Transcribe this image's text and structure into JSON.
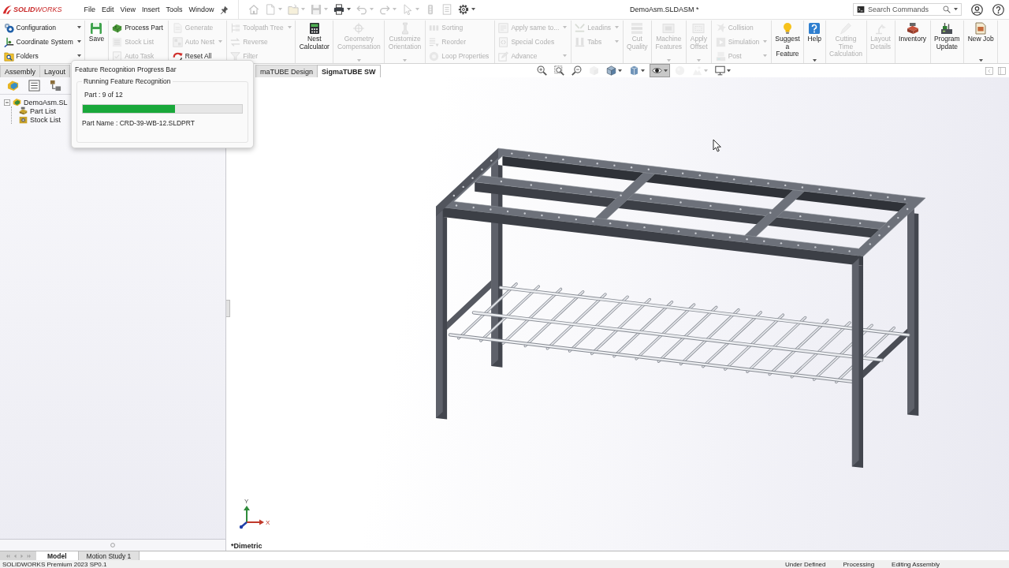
{
  "title_bar": {
    "logo": "**SOLID**WORKS",
    "menu": [
      "File",
      "Edit",
      "View",
      "Insert",
      "Tools",
      "Window"
    ],
    "quick_access": [
      {
        "disabled": true,
        "menu": false
      },
      {
        "disabled": true,
        "menu": true
      },
      {
        "disabled": true,
        "menu": true
      },
      {
        "disabled": true,
        "menu": true
      },
      {
        "disabled": false,
        "menu": true
      },
      {
        "disabled": true,
        "menu": true
      },
      {
        "disabled": true,
        "menu": true
      },
      {
        "disabled": true,
        "menu": true
      },
      {
        "disabled": true,
        "menu": false
      },
      {
        "disabled": true,
        "menu": false
      },
      {
        "disabled": false,
        "menu": true
      }
    ],
    "document_title": "DemoAsm.SLDASM *",
    "search": {
      "placeholder": "Search Commands"
    }
  },
  "ribbon": {
    "groups": [
      {
        "kind": "stack",
        "items": [
          {
            "label": "Configuration",
            "disabled": false,
            "menu": true
          },
          {
            "label": "Coordinate System",
            "disabled": false,
            "menu": true
          },
          {
            "label": "Folders",
            "disabled": false,
            "menu": true
          }
        ]
      },
      {
        "kind": "large",
        "label": "Save",
        "disabled": false,
        "menu": false
      },
      {
        "kind": "stack",
        "items": [
          {
            "label": "Process Part",
            "disabled": false,
            "menu": false
          },
          {
            "label": "Stock List",
            "disabled": true,
            "menu": false
          },
          {
            "label": "Auto Task",
            "disabled": true,
            "menu": false
          }
        ]
      },
      {
        "kind": "stack",
        "items": [
          {
            "label": "Generate",
            "disabled": true,
            "menu": false
          },
          {
            "label": "Auto Nest",
            "disabled": true,
            "menu": true
          },
          {
            "label": "Reset All",
            "disabled": false,
            "menu": false
          }
        ]
      },
      {
        "kind": "stack",
        "items": [
          {
            "label": "Toolpath Tree",
            "disabled": true,
            "menu": true
          },
          {
            "label": "Reverse",
            "disabled": true,
            "menu": false
          },
          {
            "label": "Filter",
            "disabled": true,
            "menu": false
          }
        ]
      },
      {
        "kind": "large",
        "label": "Nest\nCalculator",
        "disabled": false,
        "menu": false
      },
      {
        "kind": "large",
        "label": "Geometry\nCompensation",
        "disabled": true,
        "menu": true
      },
      {
        "kind": "large",
        "label": "Customize\nOrientation",
        "disabled": true,
        "menu": true
      },
      {
        "kind": "stack",
        "items": [
          {
            "label": "Sorting",
            "disabled": true,
            "menu": false
          },
          {
            "label": "Reorder",
            "disabled": true,
            "menu": false
          },
          {
            "label": "Loop Properties",
            "disabled": true,
            "menu": false
          }
        ]
      },
      {
        "kind": "stack",
        "items": [
          {
            "label": "Apply same to...",
            "disabled": true,
            "menu": true
          },
          {
            "label": "Special Codes",
            "disabled": true,
            "menu": false
          },
          {
            "label": "Advance",
            "disabled": true,
            "menu": true
          }
        ]
      },
      {
        "kind": "stack",
        "items": [
          {
            "label": "Leadins",
            "disabled": true,
            "menu": true
          },
          {
            "label": "Tabs",
            "disabled": true,
            "menu": true
          }
        ]
      },
      {
        "kind": "large",
        "label": "Cut\nQuality",
        "disabled": true,
        "menu": false
      },
      {
        "kind": "large",
        "label": "Machine\nFeatures",
        "disabled": true,
        "menu": true
      },
      {
        "kind": "large",
        "label": "Apply\nOffset",
        "disabled": true,
        "menu": true
      },
      {
        "kind": "stack",
        "items": [
          {
            "label": "Collision",
            "disabled": true,
            "menu": false
          },
          {
            "label": "Simulation",
            "disabled": true,
            "menu": true
          },
          {
            "label": "Post",
            "disabled": true,
            "menu": true
          }
        ]
      },
      {
        "kind": "large",
        "label": "Suggest\na\nFeature",
        "disabled": false,
        "menu": false
      },
      {
        "kind": "large",
        "label": "Help",
        "disabled": false,
        "menu": true
      },
      {
        "kind": "large",
        "label": "Cutting\nTime\nCalculation",
        "disabled": true,
        "menu": false
      },
      {
        "kind": "large",
        "label": "Layout\nDetails",
        "disabled": true,
        "menu": false
      },
      {
        "kind": "large",
        "label": "Inventory",
        "disabled": false,
        "menu": false
      },
      {
        "kind": "large",
        "label": "Program\nUpdate",
        "disabled": false,
        "menu": false
      },
      {
        "kind": "large",
        "label": "New Job",
        "disabled": false,
        "menu": true
      }
    ]
  },
  "command_tabs": [
    {
      "label": "Assembly",
      "selected": false
    },
    {
      "label": "Layout",
      "selected": false
    },
    {
      "label": "maTUBE Design",
      "selected": false
    },
    {
      "label": "SigmaTUBE SW",
      "selected": true
    }
  ],
  "feature_tree": {
    "items": [
      {
        "label": "DemoAsm.SL",
        "expanded": true,
        "children": [
          {
            "label": "Part List"
          },
          {
            "label": "Stock List"
          }
        ]
      }
    ]
  },
  "progress_dialog": {
    "title": "Feature Recognition Progress Bar",
    "group": "Running Feature Recognition",
    "part": "Part : 9 of 12",
    "level": 0.58,
    "part_name": "Part Name : CRD-39-WB-12.SLDPRT"
  },
  "viewport": {
    "view_toolbar": [
      {
        "disabled": false,
        "menu": false,
        "selected": false
      },
      {
        "disabled": false,
        "menu": false,
        "selected": false
      },
      {
        "disabled": false,
        "menu": false,
        "selected": false
      },
      {
        "disabled": true,
        "menu": false,
        "selected": false
      },
      {
        "disabled": false,
        "menu": true,
        "selected": false
      },
      {
        "disabled": false,
        "menu": true,
        "selected": false
      },
      {
        "disabled": false,
        "menu": true,
        "selected": true
      },
      {
        "disabled": true,
        "menu": false,
        "selected": false
      },
      {
        "disabled": true,
        "menu": true,
        "selected": false
      },
      {
        "disabled": false,
        "menu": true,
        "selected": false
      }
    ],
    "triad": {
      "y_label": "Y",
      "x_label": "X"
    },
    "view_name": "*Dimetric"
  },
  "model_nav": [
    {
      "disabled": true
    },
    {
      "disabled": true
    },
    {
      "disabled": true
    },
    {
      "disabled": true
    }
  ],
  "bottom_tabs": [
    {
      "label": "Model",
      "selected": true
    },
    {
      "label": "Motion Study 1",
      "selected": false
    }
  ],
  "status_bar": {
    "product": "SOLIDWORKS Premium 2023 SP0.1",
    "fields": [
      "Under Defined",
      "Processing",
      "Editing Assembly"
    ]
  }
}
